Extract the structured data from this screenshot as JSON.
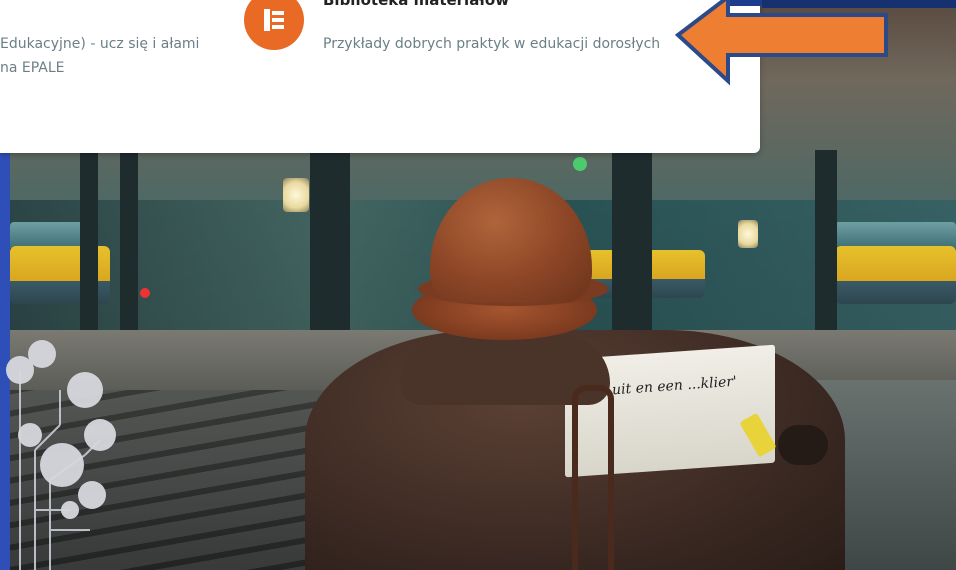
{
  "menu": {
    "left_item": {
      "description": "Edukacyjne) - ucz się i ałami na EPALE"
    },
    "library_item": {
      "icon": "library-book-icon",
      "title": "Biblioteka materiałów",
      "description": "Przykłady dobrych praktyk w edukacji dorosłych"
    }
  },
  "hero": {
    "newspaper_text": "uit en een ...klier'"
  },
  "annotation": {
    "arrow_color": "#ee7e32",
    "arrow_outline": "#2c4a8a"
  },
  "colors": {
    "accent_blue": "#2f4fb8",
    "library_icon_bg": "#e86a24"
  }
}
